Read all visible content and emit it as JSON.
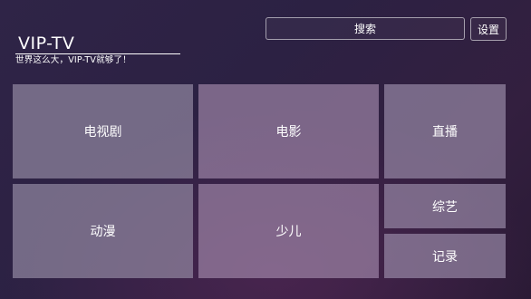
{
  "header": {
    "logo_title": "VIP-TV",
    "logo_slogan": "世界这么大，VIP-TV就够了！",
    "search_label": "搜索",
    "settings_label": "设置"
  },
  "categories": {
    "tv_series": "电视剧",
    "movie": "电影",
    "live": "直播",
    "anime": "动漫",
    "kids": "少儿",
    "variety": "综艺",
    "documentary": "记录"
  },
  "colors": {
    "background": "#2e2244",
    "tile": "#8a7c96",
    "text": "#ffffff"
  }
}
